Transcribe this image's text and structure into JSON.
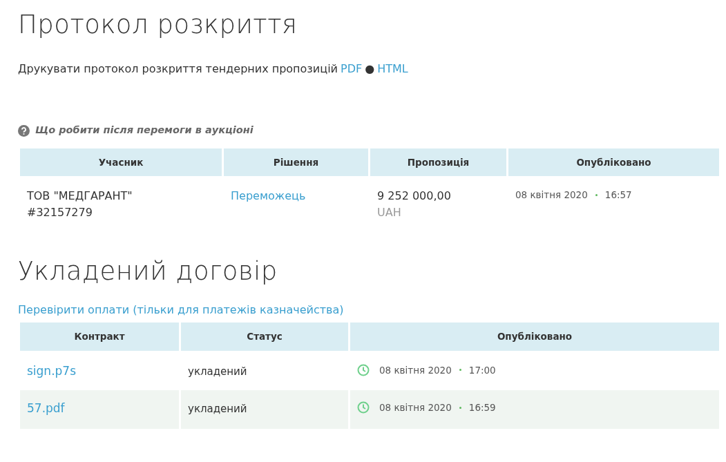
{
  "protocol": {
    "title": "Протокол розкриття",
    "print_text": "Друкувати протокол розкриття тендерних пропозицій",
    "links": [
      "PDF",
      "HTML"
    ],
    "separator": "●"
  },
  "help_link": "Що робити після перемоги в аукціоні",
  "bids_table": {
    "columns": [
      "Учасник",
      "Рішення",
      "Пропозиція",
      "Опубліковано"
    ],
    "rows": [
      {
        "participant": "ТОВ \"МЕДГАРАНТ\" #32157279",
        "decision": "Переможець",
        "amount": "9 252 000,00",
        "currency": "UAH",
        "date": "08 квітня 2020",
        "time": "16:57"
      }
    ]
  },
  "contract": {
    "title": "Укладений договір",
    "payments_link": "Перевірити оплати (тільки для платежів казначейства)",
    "columns": [
      "Контракт",
      "Статус",
      "Опубліковано"
    ],
    "rows": [
      {
        "file": "sign.p7s",
        "status": "укладений",
        "date": "08 квітня 2020",
        "time": "17:00"
      },
      {
        "file": "57.pdf",
        "status": "укладений",
        "date": "08 квітня 2020",
        "time": "16:59"
      }
    ]
  }
}
